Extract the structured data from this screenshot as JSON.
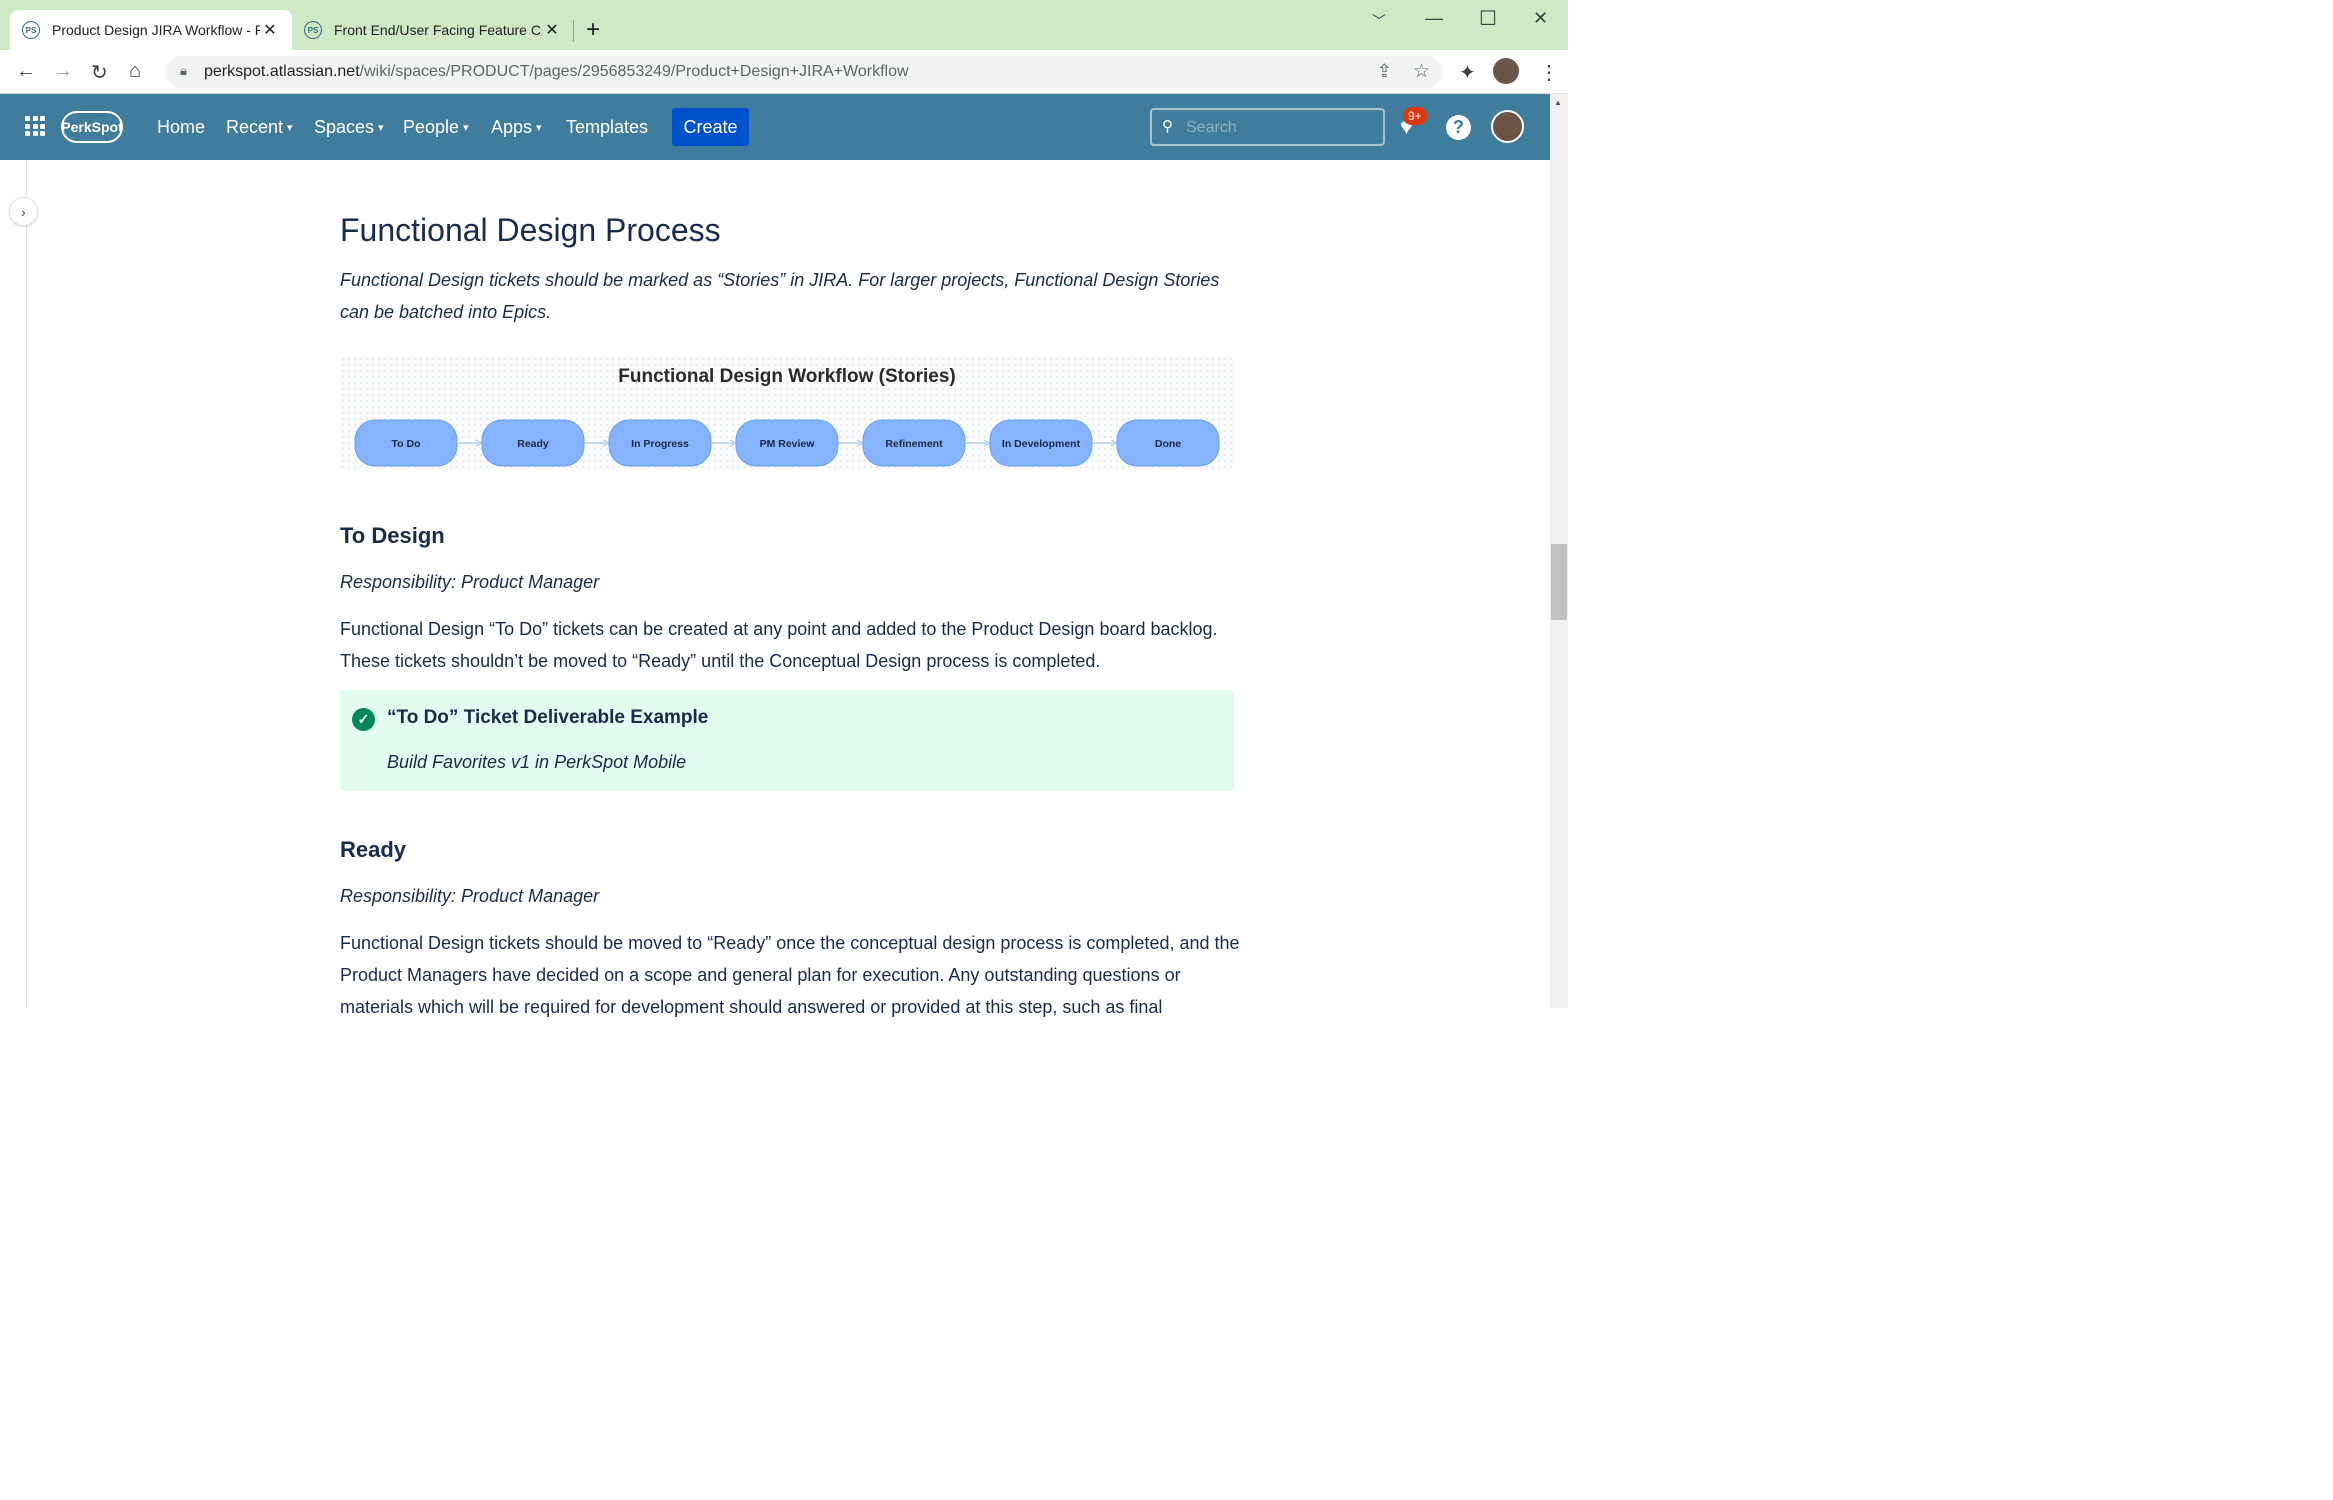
{
  "browser": {
    "tabs": [
      {
        "favicon": "PS",
        "title": "Product Design JIRA Workflow - PerkSpot",
        "close": "✕"
      },
      {
        "favicon": "PS",
        "title": "Front End/User Facing Feature Checklist",
        "close": "✕"
      }
    ],
    "new_tab": "+",
    "url_host": "perkspot.atlassian.net",
    "url_path": "/wiki/spaces/PRODUCT/pages/2956853249/Product+Design+JIRA+Workflow"
  },
  "nav": {
    "logo": "PerkSpot",
    "items": [
      {
        "label": "Home",
        "dropdown": false
      },
      {
        "label": "Recent",
        "dropdown": true
      },
      {
        "label": "Spaces",
        "dropdown": true
      },
      {
        "label": "People",
        "dropdown": true
      },
      {
        "label": "Apps",
        "dropdown": true
      },
      {
        "label": "Templates",
        "dropdown": false
      }
    ],
    "create_label": "Create",
    "search_placeholder": "Search",
    "notification_badge": "9+",
    "help": "?"
  },
  "page": {
    "heading": "Functional Design Process",
    "intro": "Functional Design tickets should be marked as “Stories” in JIRA. For larger projects, Functional Design Stories can be batched into Epics.",
    "diagram": {
      "title": "Functional Design Workflow (Stories)",
      "steps": [
        "To Do",
        "Ready",
        "In Progress",
        "PM Review",
        "Refinement",
        "In Development",
        "Done"
      ],
      "fill": "#85b3ff",
      "stroke": "#6b9ef2"
    },
    "sections": [
      {
        "heading": "To Design",
        "responsibility": "Responsibility: Product Manager",
        "body": "Functional Design “To Do” tickets can be created at any point and added to the Product Design board backlog. These tickets shouldn’t be moved to “Ready” until the Conceptual Design process is completed."
      },
      {
        "heading": "Ready",
        "responsibility": "Responsibility: Product Manager",
        "body": "Functional Design tickets should be moved to “Ready” once the conceptual design process is completed, and the Product Managers have decided on a scope and general plan for execution. Any outstanding questions or materials which will be required for development should answered or provided at this step, such as final"
      }
    ],
    "panel": {
      "title": "“To Do” Ticket Deliverable Example",
      "body": "Build Favorites v1 in PerkSpot Mobile"
    }
  }
}
